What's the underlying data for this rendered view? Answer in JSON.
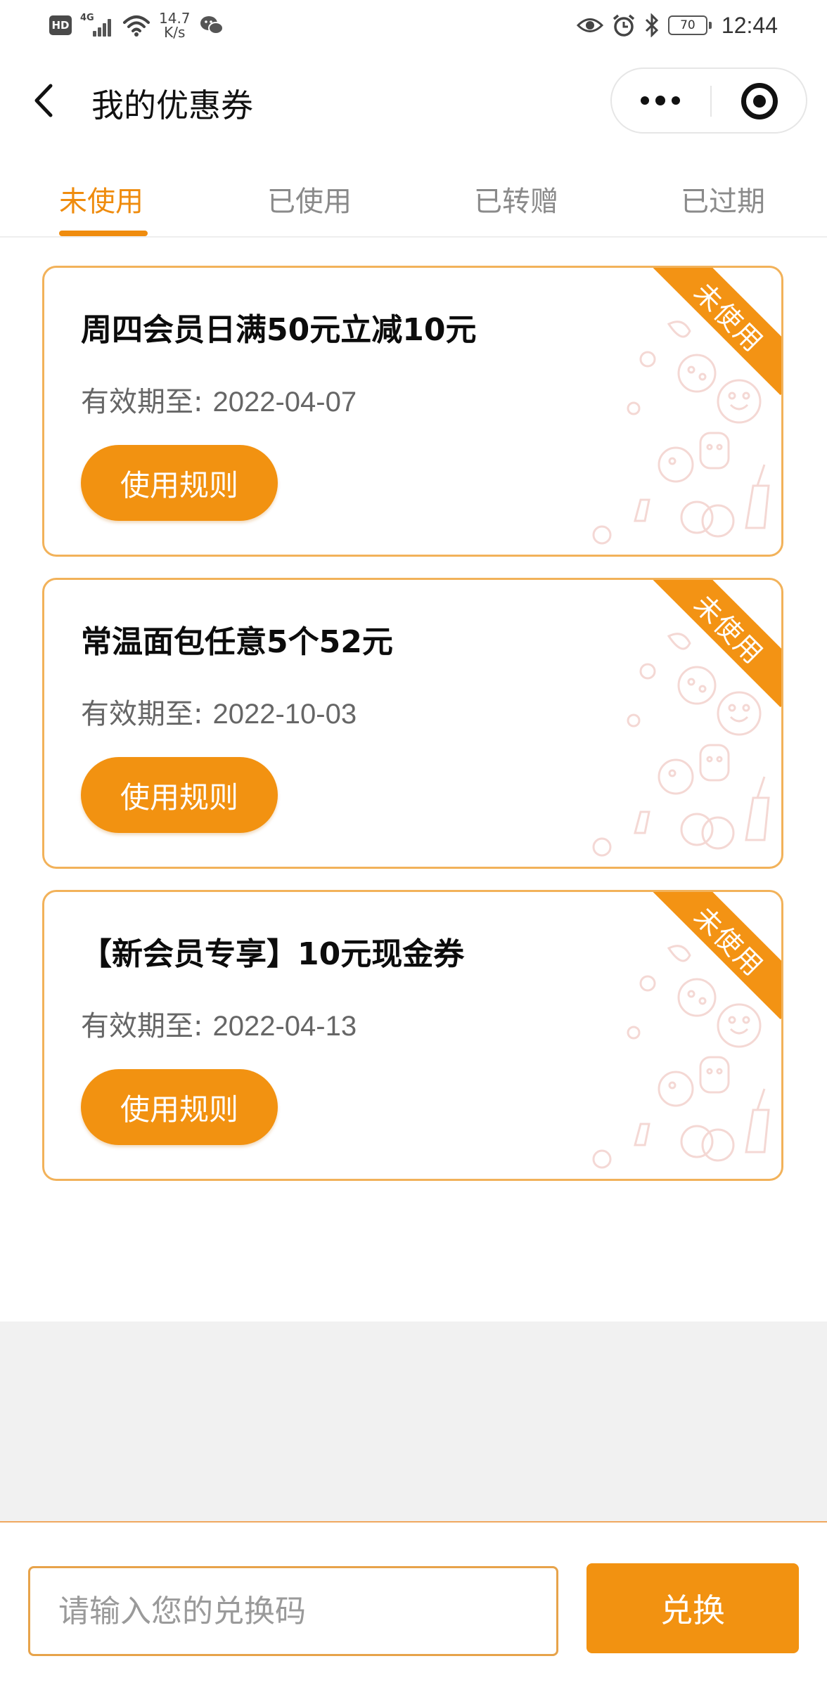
{
  "status_bar": {
    "hd": "HD",
    "network": "4G",
    "speed_value": "14.7",
    "speed_unit": "K/s",
    "battery": "70",
    "time": "12:44"
  },
  "header": {
    "title": "我的优惠券"
  },
  "tabs": [
    {
      "label": "未使用",
      "active": true
    },
    {
      "label": "已使用",
      "active": false
    },
    {
      "label": "已转赠",
      "active": false
    },
    {
      "label": "已过期",
      "active": false
    }
  ],
  "coupons": [
    {
      "title": "周四会员日满50元立减10元",
      "expiry_label": "有效期至:",
      "expiry_date": "2022-04-07",
      "button": "使用规则",
      "badge": "未使用"
    },
    {
      "title": "常温面包任意5个52元",
      "expiry_label": "有效期至:",
      "expiry_date": "2022-10-03",
      "button": "使用规则",
      "badge": "未使用"
    },
    {
      "title": "【新会员专享】10元现金券",
      "expiry_label": "有效期至:",
      "expiry_date": "2022-04-13",
      "button": "使用规则",
      "badge": "未使用"
    }
  ],
  "footer": {
    "placeholder": "请输入您的兑换码",
    "redeem_label": "兑换"
  },
  "colors": {
    "accent": "#f29211",
    "tab_active": "#ef8c0e",
    "card_border": "#f2b25a"
  }
}
